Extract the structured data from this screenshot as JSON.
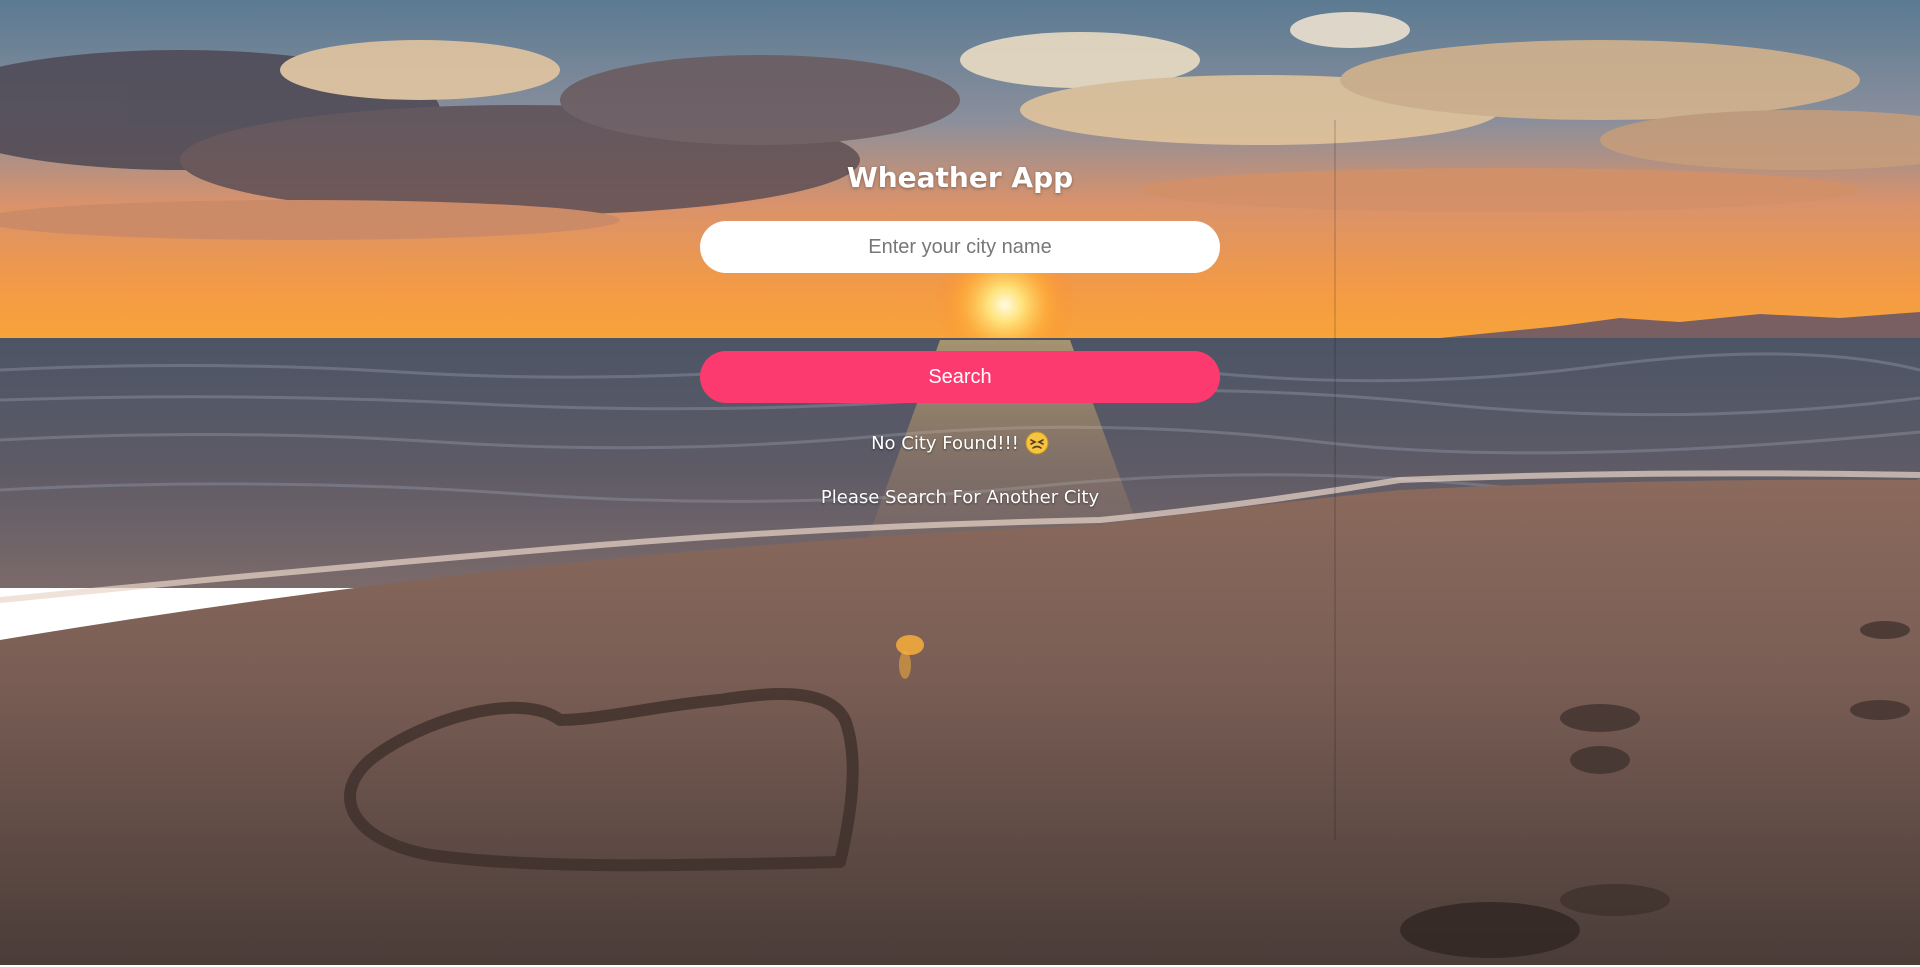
{
  "app": {
    "title": "Wheather App"
  },
  "search": {
    "placeholder": "Enter your city name",
    "value": "",
    "button_label": "Search"
  },
  "result": {
    "message": "No City Found!!!",
    "emoji_icon": "persevering-face-icon",
    "hint": "Please Search For Another City"
  },
  "theme": {
    "button_color": "#fd3a6f",
    "text_color": "#ffffff",
    "input_background": "#ffffff"
  },
  "background": {
    "icon": "beach-sunset-heart-in-sand"
  }
}
